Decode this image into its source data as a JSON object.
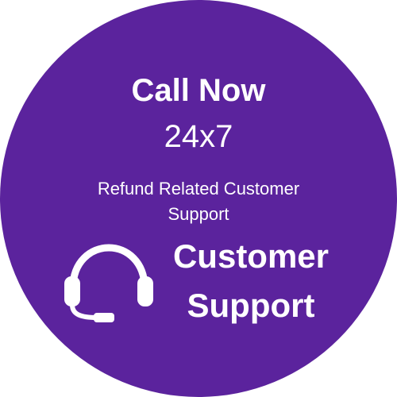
{
  "badge": {
    "background_color": "#5b239d",
    "text_color": "#ffffff"
  },
  "headline": "Call Now",
  "hours": "24x7",
  "subtext": {
    "line1": "Refund Related Customer",
    "line2": "Support"
  },
  "icon": "headset-icon",
  "support_title": {
    "line1": "Customer",
    "line2": "Support"
  }
}
